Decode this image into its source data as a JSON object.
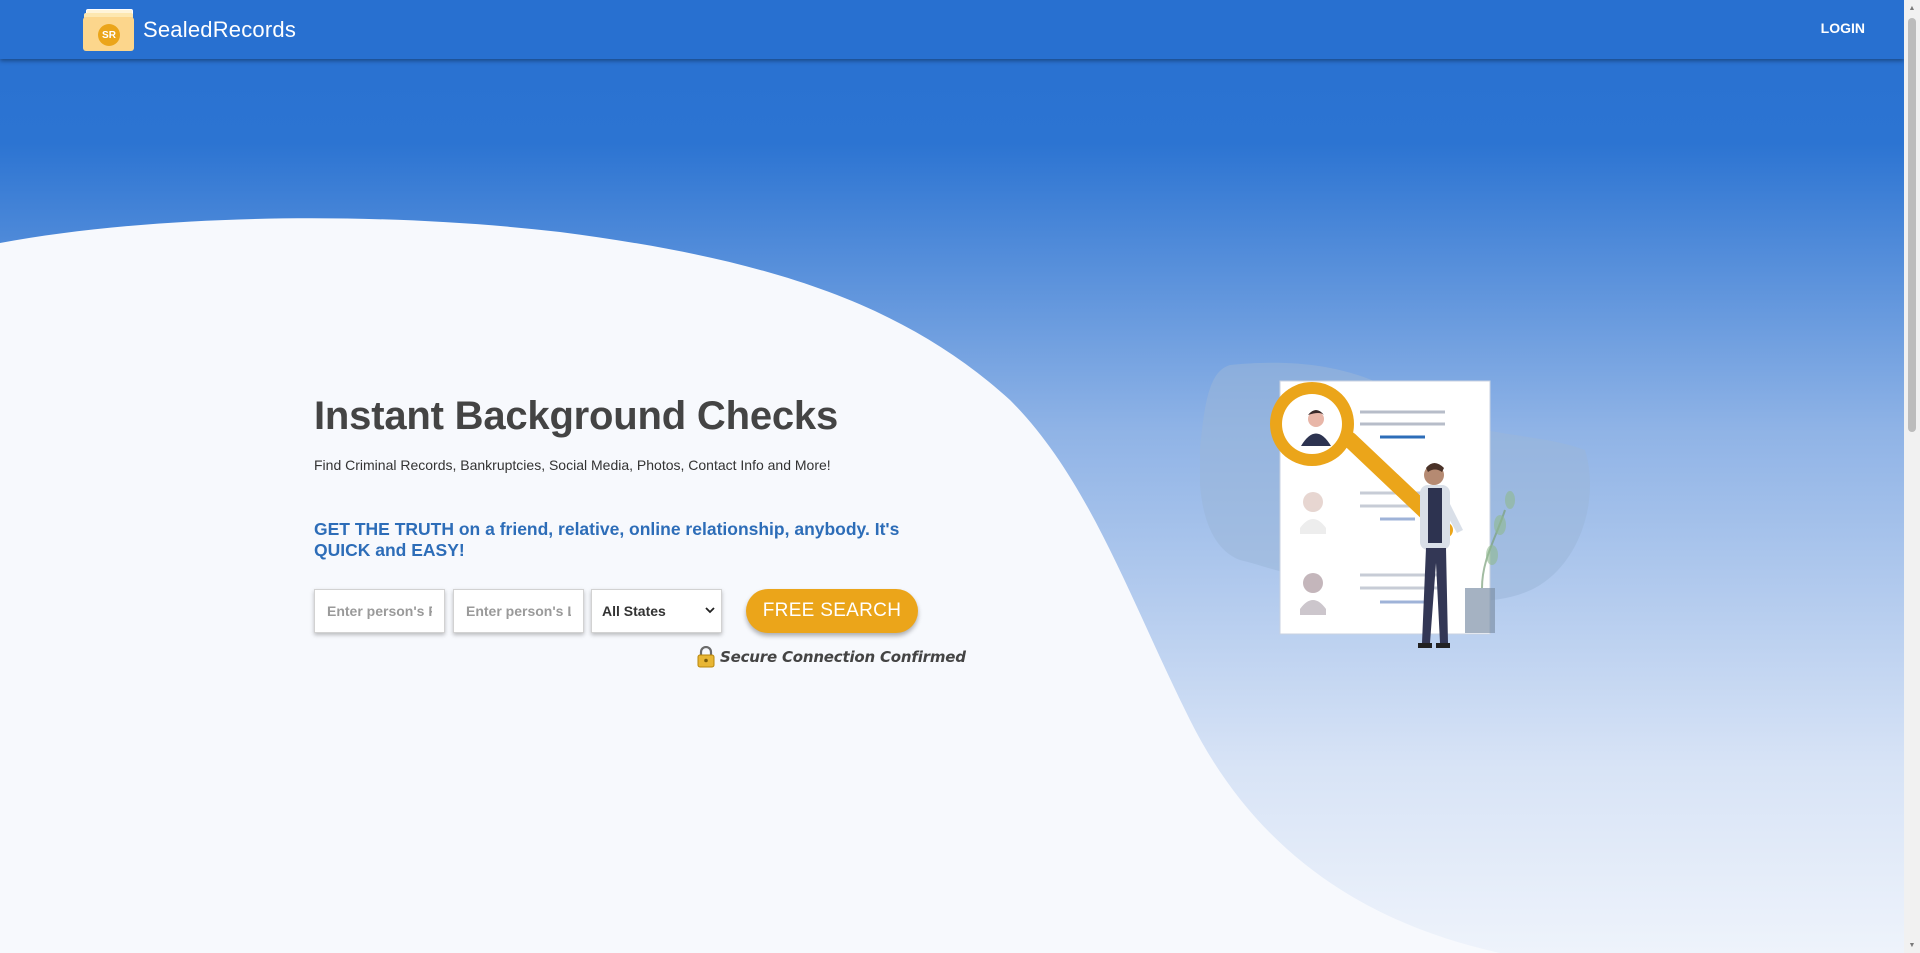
{
  "navbar": {
    "logo_initials": "SR",
    "brand_name": "SealedRecords",
    "login_label": "LOGIN"
  },
  "hero": {
    "title": "Instant Background Checks",
    "subtitle": "Find Criminal Records, Bankruptcies, Social Media, Photos, Contact Info and More!",
    "tagline": "GET THE TRUTH on a friend, relative, online relationship, anybody. It's QUICK and EASY!"
  },
  "search": {
    "first_name_placeholder": "Enter person's First Name",
    "last_name_placeholder": "Enter person's Last Name",
    "state_selected": "All States",
    "button_label": "FREE SEARCH"
  },
  "secure": {
    "text": "Secure Connection Confirmed",
    "icon": "padlock-icon"
  },
  "colors": {
    "navbar": "#2870d0",
    "accent_orange": "#eba51a",
    "tagline_blue": "#2d6db8",
    "title_gray": "#444444",
    "page_bg": "#f7f9fd"
  }
}
